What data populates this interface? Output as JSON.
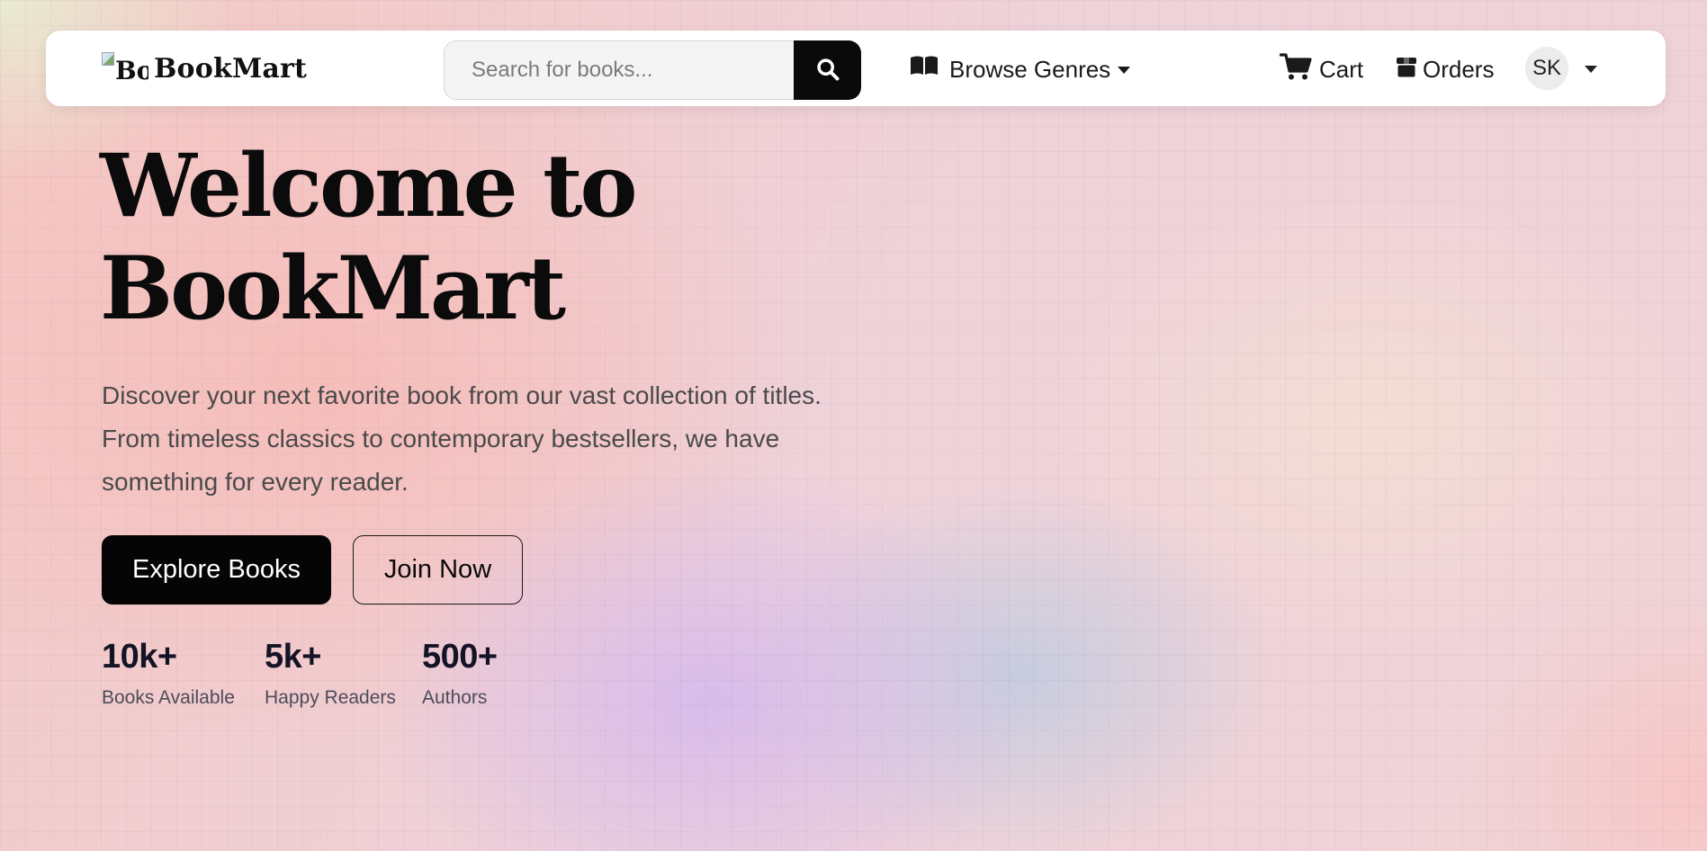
{
  "navbar": {
    "logo_alt": "Bo",
    "brand_name": "BookMart",
    "search": {
      "placeholder": "Search for books...",
      "icon": "search-icon"
    },
    "genres": {
      "icon": "book-open-icon",
      "label": "Browse Genres"
    },
    "cart": {
      "icon": "shopping-cart-icon",
      "label": "Cart"
    },
    "orders": {
      "icon": "box-icon",
      "label": "Orders"
    },
    "user": {
      "initials": "SK",
      "dropdown_icon": "caret-down-icon"
    }
  },
  "hero": {
    "title_line1": "Welcome to",
    "title_line2": "BookMart",
    "description": "Discover your next favorite book from our vast collection of titles. From timeless classics to contemporary bestsellers, we have something for every reader.",
    "primary_button": "Explore Books",
    "secondary_button": "Join Now"
  },
  "stats": [
    {
      "value": "10k+",
      "label": "Books Available"
    },
    {
      "value": "5k+",
      "label": "Happy Readers"
    },
    {
      "value": "500+",
      "label": "Authors"
    }
  ],
  "colors": {
    "accent": "#0a0a0a",
    "navbar_bg": "#ffffff",
    "text_muted": "#4a4a4a"
  }
}
